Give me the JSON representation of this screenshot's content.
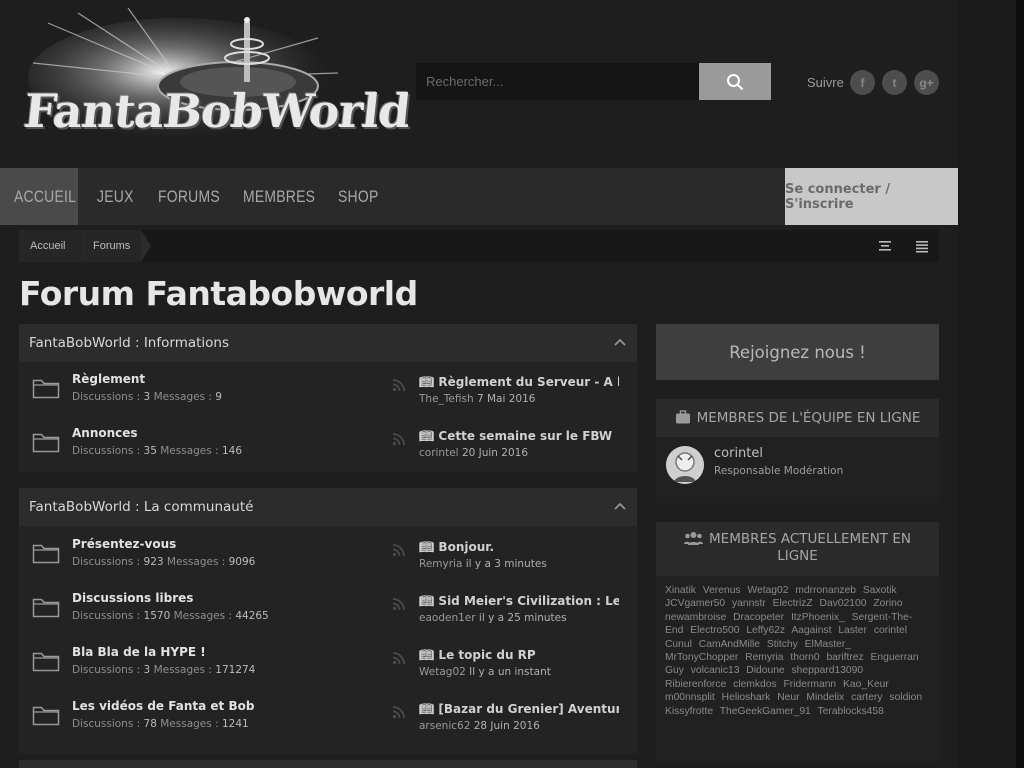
{
  "header": {
    "logo_text": "FantaBobWorld",
    "search_placeholder": "Rechercher...",
    "follow_label": "Suivre",
    "social": [
      "f",
      "t",
      "g+"
    ]
  },
  "nav": {
    "items": [
      "ACCUEIL",
      "JEUX",
      "FORUMS",
      "MEMBRES",
      "SHOP"
    ],
    "active": "ACCUEIL",
    "login_label": "Se connecter / S'inscrire"
  },
  "breadcrumb": [
    "Accueil",
    "Forums"
  ],
  "page_title": "Forum Fantabobworld",
  "categories": [
    {
      "title": "FantaBobWorld : Informations",
      "forums": [
        {
          "name": "Règlement",
          "discussions": "3",
          "messages": "9",
          "last_post_title": "Règlement du Serveur - A lire ...",
          "last_post_user": "The_Tefish",
          "last_post_date": "7 Mai 2016"
        },
        {
          "name": "Annonces",
          "discussions": "35",
          "messages": "146",
          "last_post_title": "Cette semaine sur le FBW",
          "last_post_user": "corintel",
          "last_post_date": "20 Juin 2016"
        }
      ]
    },
    {
      "title": "FantaBobWorld : La communauté",
      "forums": [
        {
          "name": "Présentez-vous",
          "discussions": "923",
          "messages": "9096",
          "last_post_title": "Bonjour.",
          "last_post_user": "Remyria",
          "last_post_date": "il y a 3 minutes"
        },
        {
          "name": "Discussions libres",
          "discussions": "1570",
          "messages": "44265",
          "last_post_title": "Sid Meier's Civilization : Le to...",
          "last_post_user": "eaoden1er",
          "last_post_date": "il y a 25 minutes"
        },
        {
          "name": "Bla Bla de la HYPE !",
          "discussions": "3",
          "messages": "171274",
          "last_post_title": "Le topic du RP",
          "last_post_user": "Wetag02",
          "last_post_date": "Il y a un instant"
        },
        {
          "name": "Les vidéos de Fanta et Bob",
          "discussions": "78",
          "messages": "1241",
          "last_post_title": "[Bazar du Grenier] Aventures ...",
          "last_post_user": "arsenic62",
          "last_post_date": "28 Juin 2016"
        }
      ]
    }
  ],
  "labels": {
    "discussions": "Discussions :",
    "messages": "Messages :"
  },
  "sidebar": {
    "join_label": "Rejoignez nous !",
    "staff_title": "MEMBRES DE L'ÉQUIPE EN LIGNE",
    "staff": [
      {
        "name": "corintel",
        "role": "Responsable Modération"
      }
    ],
    "online_title": "MEMBRES ACTUELLEMENT EN LIGNE",
    "online_members": [
      "Xinatik",
      "Verenus",
      "Wetag02",
      "mdrronanzeb",
      "Saxotik",
      "JCVgamer50",
      "yannstr",
      "ElectrizZ",
      "Dav02100",
      "Zorino",
      "newambroise",
      "Dracopeter",
      "ItzPhoenix_",
      "Sergent-The-End",
      "Electro500",
      "Leffy62z",
      "Aagainst",
      "Laster",
      "corintel",
      "Cunul",
      "CamAndMille",
      "Stitchy",
      "ElMaster_",
      "MrTonyChopper",
      "Remyria",
      "thorn0",
      "bariftrez",
      "Enguerran Guy",
      "volcanic13",
      "Didoune",
      "sheppard13090",
      "Ribierenforce",
      "clemkdos",
      "Fridermann",
      "Kao_Keur",
      "m00nnsplit",
      "Helioshark",
      "Neur",
      "Mindelix",
      "cartery",
      "soldion",
      "Kissyfrotte",
      "TheGeekGamer_91",
      "Terablocks458"
    ]
  }
}
